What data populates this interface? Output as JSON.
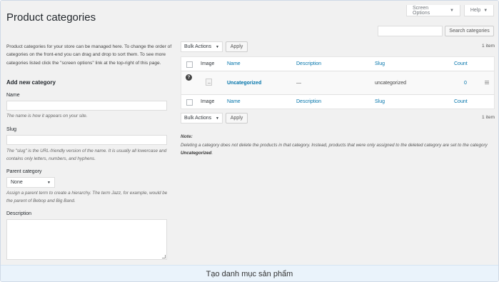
{
  "header": {
    "title": "Product categories",
    "screen_options": "Screen Options",
    "help": "Help"
  },
  "search": {
    "value": "",
    "button": "Search categories"
  },
  "form": {
    "intro": "Product categories for your store can be managed here. To change the order of categories on the front-end you can drag and drop to sort them. To see more categories listed click the \"screen options\" link at the top-right of this page.",
    "section_title": "Add new category",
    "name_label": "Name",
    "name_value": "",
    "name_help": "The name is how it appears on your site.",
    "slug_label": "Slug",
    "slug_value": "",
    "slug_help": "The \"slug\" is the URL-friendly version of the name. It is usually all lowercase and contains only letters, numbers, and hyphens.",
    "parent_label": "Parent category",
    "parent_selected": "None",
    "parent_help": "Assign a parent term to create a hierarchy. The term Jazz, for example, would be the parent of Bebop and Big Band.",
    "description_label": "Description",
    "description_value": ""
  },
  "list": {
    "bulk_actions": "Bulk Actions",
    "apply": "Apply",
    "count_label": "1 item",
    "columns": {
      "image": "Image",
      "name": "Name",
      "description": "Description",
      "slug": "Slug",
      "count": "Count"
    },
    "rows": [
      {
        "name": "Uncategorized",
        "description": "—",
        "slug": "uncategorized",
        "count": "0"
      }
    ]
  },
  "note": {
    "label": "Note:",
    "text_before": "Deleting a category does not delete the products in that category. Instead, products that were only assigned to the deleted category are set to the category ",
    "text_bold": "Uncategorized",
    "text_after": "."
  },
  "caption": "Tạo danh mục sản phẩm"
}
